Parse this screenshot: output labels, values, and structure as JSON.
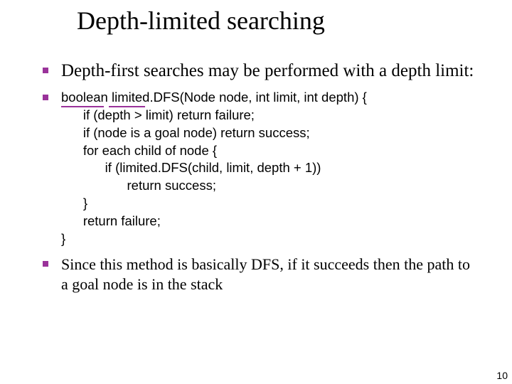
{
  "title": "Depth-limited searching",
  "bullets": {
    "lead": "Depth-first searches may be performed with a depth limit:",
    "code": "boolean limited.DFS(Node node, int limit, int depth) {\n      if (depth > limit) return failure;\n      if (node is a goal node) return success;\n      for each child of node {\n            if (limited.DFS(child, limit, depth + 1))\n                  return success;\n      }\n      return failure;\n}",
    "tail": "Since this method is basically DFS, if it succeeds then the path to a goal node is in the stack"
  },
  "page_number": "10"
}
